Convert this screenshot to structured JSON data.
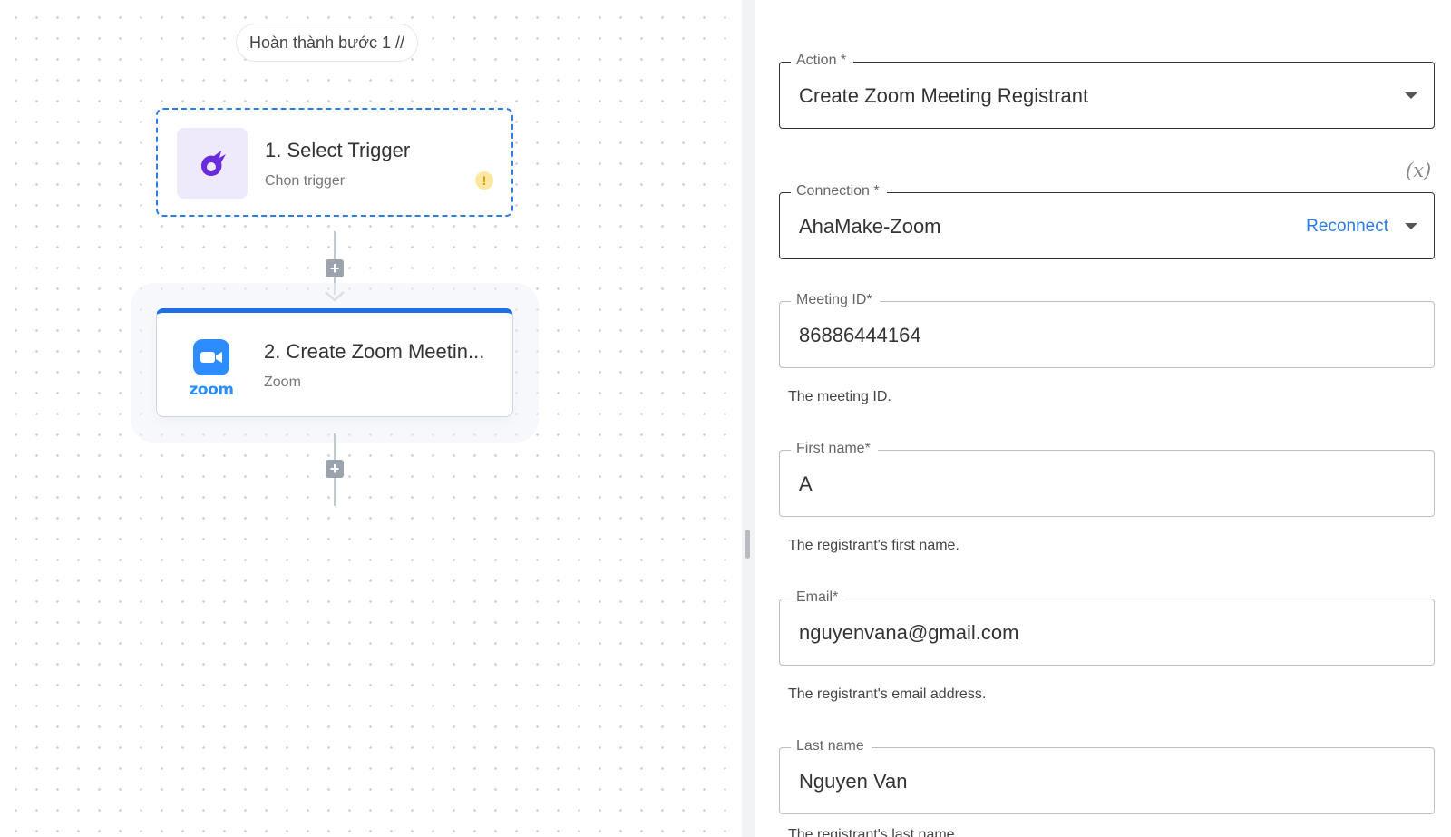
{
  "canvas": {
    "step_chip": "Hoàn thành bước 1 //",
    "nodes": [
      {
        "title": "1. Select Trigger",
        "subtitle": "Chọn trigger",
        "icon": "trigger-icon",
        "warning": "!"
      },
      {
        "title": "2. Create Zoom Meetin...",
        "subtitle": "Zoom",
        "icon": "zoom-icon",
        "logo_text": "zoom"
      }
    ]
  },
  "form": {
    "var_toggle": "(x)",
    "action": {
      "label": "Action *",
      "value": "Create Zoom Meeting Registrant"
    },
    "connection": {
      "label": "Connection *",
      "value": "AhaMake-Zoom",
      "reconnect": "Reconnect"
    },
    "meeting_id": {
      "label": "Meeting ID*",
      "value": "86886444164",
      "help": "The meeting ID."
    },
    "first_name": {
      "label": "First name*",
      "value": "A",
      "help": "The registrant's first name."
    },
    "email": {
      "label": "Email*",
      "value": "nguyenvana@gmail.com",
      "help": "The registrant's email address."
    },
    "last_name": {
      "label": "Last name",
      "value": "Nguyen Van",
      "help": "The registrant's last name."
    }
  },
  "colors": {
    "accent": "#2d7be5",
    "zoom": "#2d8cff",
    "trigger": "#6a2bdc"
  }
}
